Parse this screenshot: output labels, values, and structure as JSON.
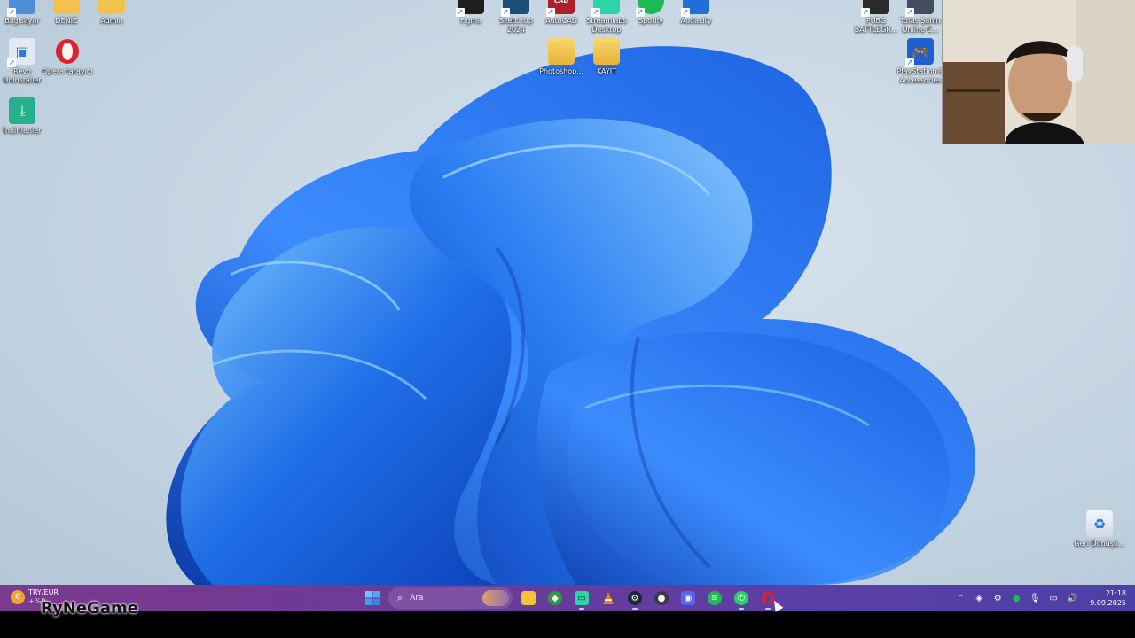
{
  "desktop_icons": [
    {
      "id": "bilgisayar",
      "label": "Bilgisayar",
      "icon": "computer-icon",
      "color": "#4a8fd8"
    },
    {
      "id": "deniz",
      "label": "DENİZ",
      "icon": "user-folder-icon",
      "color": "#f2c14e"
    },
    {
      "id": "admin",
      "label": "Admin",
      "icon": "user-folder-icon",
      "color": "#f2c14e"
    },
    {
      "id": "revo",
      "label": "Revo Uninstaller",
      "icon": "revo-uninstaller-icon",
      "color": "#2e7bd6"
    },
    {
      "id": "opera",
      "label": "Opera tarayıcı",
      "icon": "opera-icon",
      "color": "#e0202c"
    },
    {
      "id": "indirilenler",
      "label": "İndirilenler",
      "icon": "downloads-icon",
      "color": "#26b08c"
    },
    {
      "id": "figma",
      "label": "Figma",
      "icon": "figma-icon",
      "color": "#1e1e1e"
    },
    {
      "id": "sketchup",
      "label": "SketchUp 2024",
      "icon": "sketchup-icon",
      "color": "#1a4f7a"
    },
    {
      "id": "autocad",
      "label": "AutoCAD",
      "icon": "autocad-icon",
      "color": "#b0202a"
    },
    {
      "id": "streamlabs",
      "label": "Streamlabs Desktop",
      "icon": "streamlabs-icon",
      "color": "#2dd4a8"
    },
    {
      "id": "spotify",
      "label": "Spotify",
      "icon": "spotify-icon",
      "color": "#1db954"
    },
    {
      "id": "audacity",
      "label": "Audacity",
      "icon": "audacity-icon",
      "color": "#1f6fd6"
    },
    {
      "id": "photoshop",
      "label": "Photoshop...",
      "icon": "folder-icon",
      "color": "#f3c64c"
    },
    {
      "id": "kayit",
      "label": "KAYIT",
      "icon": "folder-icon",
      "color": "#f3c64c"
    },
    {
      "id": "pubg",
      "label": "PUBG BATTLEGR...",
      "icon": "pubg-icon",
      "color": "#2a2a2a"
    },
    {
      "id": "tofas",
      "label": "Tofaş Şahin Online C...",
      "icon": "tofas-icon",
      "color": "#444c60"
    },
    {
      "id": "playstation",
      "label": "PlayStation® Accessories",
      "icon": "playstation-icon",
      "color": "#1f5fd0"
    },
    {
      "id": "geridonusum",
      "label": "Geri Dönüşü...",
      "icon": "recycle-bin-icon",
      "color": "#e8f0f8"
    }
  ],
  "taskbar": {
    "widget": {
      "title": "TRY/EUR",
      "value": "+%0,..."
    },
    "search_placeholder": "Ara",
    "apps": [
      {
        "name": "start",
        "icon": "windows-start-icon",
        "color": "#3aa0ff",
        "running": false
      },
      {
        "name": "search",
        "icon": "search-icon",
        "color": "",
        "running": false
      },
      {
        "name": "file-explorer",
        "icon": "file-explorer-icon",
        "color": "#f4c237",
        "running": false
      },
      {
        "name": "app-green",
        "icon": "shield-icon",
        "color": "#2f9a43",
        "running": false
      },
      {
        "name": "streamlabs",
        "icon": "streamlabs-icon",
        "color": "#2dd4a8",
        "running": true
      },
      {
        "name": "vlc",
        "icon": "vlc-icon",
        "color": "#f07b12",
        "running": false
      },
      {
        "name": "steam",
        "icon": "steam-icon",
        "color": "#1b2838",
        "running": true
      },
      {
        "name": "obs",
        "icon": "obs-icon",
        "color": "#3a3a4a",
        "running": false
      },
      {
        "name": "discord",
        "icon": "discord-icon",
        "color": "#5865f2",
        "running": false
      },
      {
        "name": "spotify",
        "icon": "spotify-icon",
        "color": "#1db954",
        "running": false
      },
      {
        "name": "whatsapp",
        "icon": "whatsapp-icon",
        "color": "#25d366",
        "running": true
      },
      {
        "name": "opera",
        "icon": "opera-icon",
        "color": "#e0202c",
        "running": true
      }
    ],
    "tray": {
      "time": "21:18",
      "date": "9.09.2025"
    }
  },
  "watermark": "RyNeGame"
}
